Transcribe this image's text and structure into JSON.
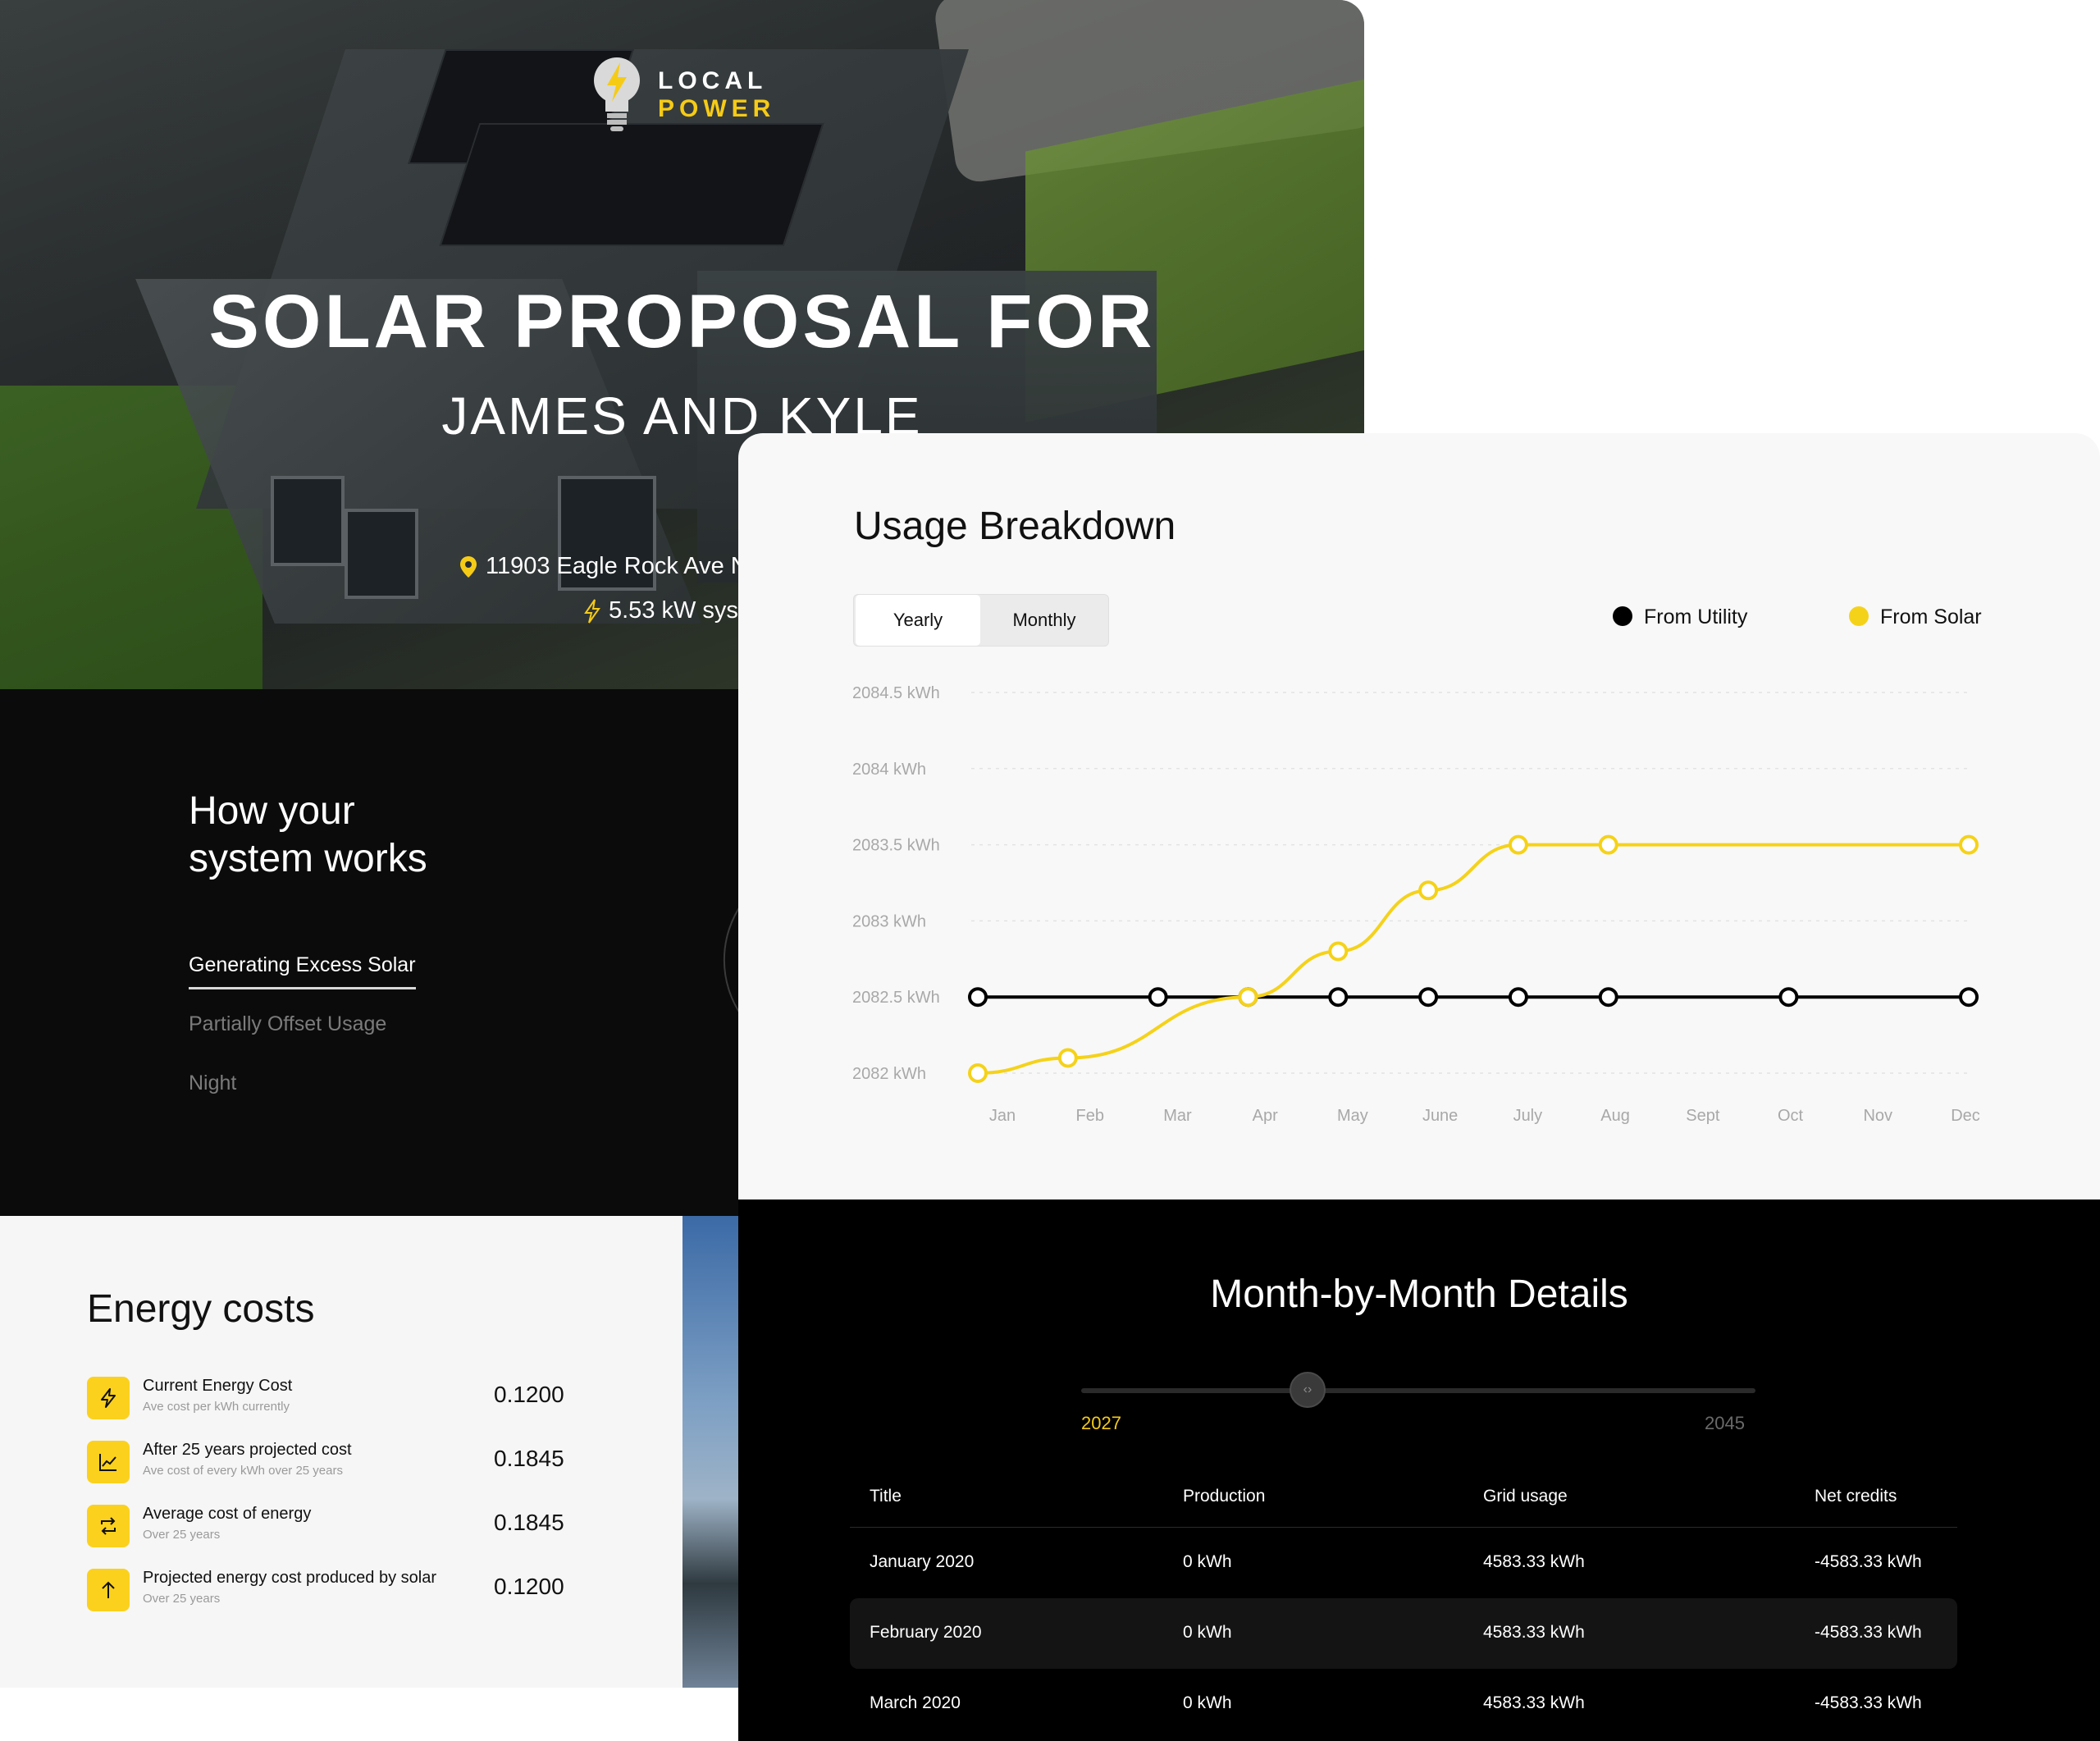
{
  "hero": {
    "logo_line1": "LOCAL",
    "logo_line2": "POWER",
    "title": "SOLAR PROPOSAL FOR",
    "subtitle": "JAMES AND KYLE",
    "address": "11903 Eagle Rock Ave N",
    "system": "5.53 kW sys"
  },
  "how": {
    "title_line1": "How your",
    "title_line2": "system works",
    "options": [
      "Generating Excess Solar",
      "Partially Offset Usage",
      "Night"
    ]
  },
  "costs": {
    "title": "Energy costs",
    "rows": [
      {
        "label": "Current Energy Cost",
        "sub": "Ave cost per kWh currently",
        "value": "0.1200",
        "icon": "bolt-icon"
      },
      {
        "label": "After 25 years projected cost",
        "sub": "Ave cost of every kWh over 25 years",
        "value": "0.1845",
        "icon": "trend-chart-icon"
      },
      {
        "label": "Average cost of energy",
        "sub": "Over 25 years",
        "value": "0.1845",
        "icon": "repeat-icon"
      },
      {
        "label": "Projected energy cost produced by solar",
        "sub": "Over 25 years",
        "value": "0.1200",
        "icon": "arrow-up-icon"
      }
    ]
  },
  "usage": {
    "title": "Usage Breakdown",
    "toggle": [
      "Yearly",
      "Monthly"
    ],
    "legend": [
      "From Utility",
      "From Solar"
    ]
  },
  "chart_data": {
    "type": "line",
    "title": "Usage Breakdown",
    "x": [
      "Jan",
      "Feb",
      "Mar",
      "Apr",
      "May",
      "June",
      "July",
      "Aug",
      "Sept",
      "Oct",
      "Nov",
      "Dec"
    ],
    "y_ticks": [
      "2084.5 kWh",
      "2084 kWh",
      "2083.5 kWh",
      "2083 kWh",
      "2082.5 kWh",
      "2082 kWh"
    ],
    "ylim": [
      2082,
      2084.5
    ],
    "grid": true,
    "legend_position": "top-right",
    "series": [
      {
        "name": "From Utility",
        "color": "#000000",
        "points": [
          [
            "Jan",
            2082.5
          ],
          [
            "Mar",
            2082.5
          ],
          [
            "Apr",
            2082.5
          ],
          [
            "May",
            2082.5
          ],
          [
            "June",
            2082.5
          ],
          [
            "July",
            2082.5
          ],
          [
            "Aug",
            2082.5
          ],
          [
            "Oct",
            2082.5
          ],
          [
            "Dec",
            2082.5
          ]
        ]
      },
      {
        "name": "From Solar",
        "color": "#f5d21a",
        "points": [
          [
            "Jan",
            2082
          ],
          [
            "Feb",
            2082.1
          ],
          [
            "Apr",
            2082.5
          ],
          [
            "May",
            2082.8
          ],
          [
            "June",
            2083.2
          ],
          [
            "July",
            2083.5
          ],
          [
            "Aug",
            2083.5
          ],
          [
            "Dec",
            2083.5
          ]
        ]
      }
    ]
  },
  "mbm": {
    "title": "Month-by-Month Details",
    "year_start": "2027",
    "year_end": "2045",
    "knob": "‹›",
    "headers": [
      "Title",
      "Production",
      "Grid usage",
      "Net credits"
    ],
    "rows": [
      [
        "January 2020",
        "0 kWh",
        "4583.33 kWh",
        "-4583.33 kWh"
      ],
      [
        "February 2020",
        "0 kWh",
        "4583.33 kWh",
        "-4583.33 kWh"
      ],
      [
        "March 2020",
        "0 kWh",
        "4583.33 kWh",
        "-4583.33 kWh"
      ]
    ]
  }
}
